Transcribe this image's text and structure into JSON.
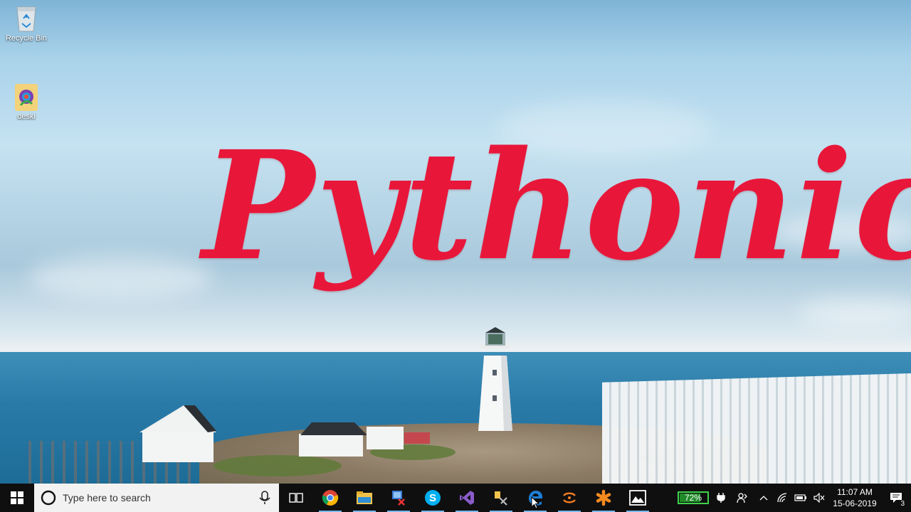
{
  "desktop": {
    "wallpaper_title": "Pythonic",
    "icons": [
      {
        "label": "Recycle Bin",
        "icon": "recycle-bin-icon"
      },
      {
        "label": "deski",
        "icon": "desktop-shortcut-icon"
      }
    ]
  },
  "taskbar": {
    "start_icon": "windows-logo-icon",
    "search_placeholder": "Type here to search",
    "search_icon": "cortana-circle-icon",
    "mic_icon": "microphone-icon",
    "pinned_apps": [
      {
        "name": "Task View",
        "icon": "task-view-icon",
        "active": false
      },
      {
        "name": "Google Chrome",
        "icon": "chrome-icon",
        "active": true
      },
      {
        "name": "File Explorer",
        "icon": "file-explorer-icon",
        "active": true
      },
      {
        "name": "Network tool",
        "icon": "network-app-icon",
        "active": true
      },
      {
        "name": "Skype",
        "icon": "skype-icon",
        "active": true
      },
      {
        "name": "Visual Studio",
        "icon": "visual-studio-icon",
        "active": true
      },
      {
        "name": "Tools",
        "icon": "tools-app-icon",
        "active": true
      },
      {
        "name": "Microsoft Edge",
        "icon": "edge-icon",
        "active": true
      },
      {
        "name": "Sync app",
        "icon": "sync-app-icon",
        "active": true
      },
      {
        "name": "Asterisk app",
        "icon": "asterisk-app-icon",
        "active": true
      },
      {
        "name": "Photos",
        "icon": "photos-icon",
        "active": true
      }
    ],
    "tray": {
      "battery_percent": "72%",
      "battery_level": 0.72,
      "time": "11:07 AM",
      "date": "15-06-2019",
      "notification_count": "3"
    }
  },
  "colors": {
    "title_red": "#e8173a",
    "taskbar_bg": "#0f0f10",
    "battery_green": "#3fd14a",
    "active_indicator": "#76b9ed"
  }
}
